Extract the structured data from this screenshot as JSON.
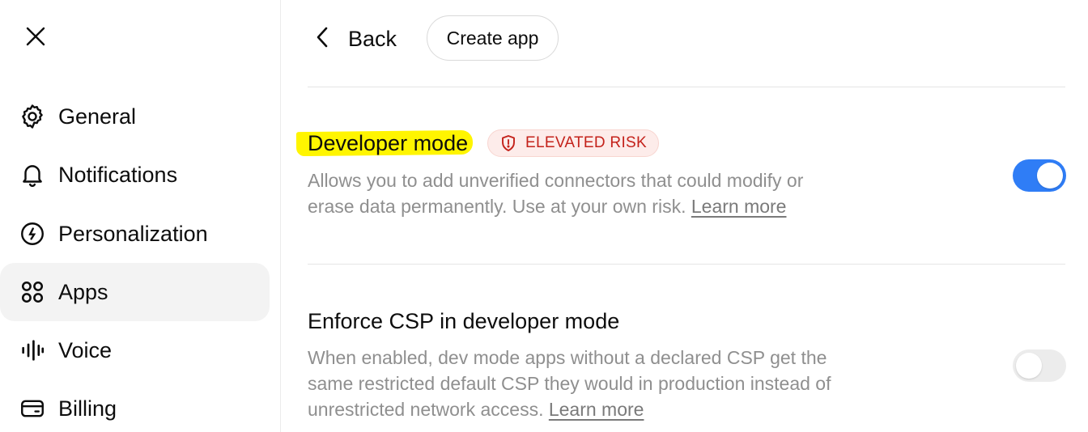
{
  "sidebar": {
    "close_icon": "close-icon",
    "items": [
      {
        "label": "General",
        "icon": "gear-icon",
        "active": false
      },
      {
        "label": "Notifications",
        "icon": "bell-icon",
        "active": false
      },
      {
        "label": "Personalization",
        "icon": "personalization-icon",
        "active": false
      },
      {
        "label": "Apps",
        "icon": "apps-grid-icon",
        "active": true
      },
      {
        "label": "Voice",
        "icon": "voice-wave-icon",
        "active": false
      },
      {
        "label": "Billing",
        "icon": "card-icon",
        "active": false
      }
    ]
  },
  "header": {
    "back_label": "Back",
    "create_app_label": "Create app"
  },
  "settings": {
    "developer_mode": {
      "title": "Developer mode",
      "badge": "ELEVATED RISK",
      "description": "Allows you to add unverified connectors that could modify or erase data permanently. Use at your own risk.",
      "learn_more": "Learn more",
      "enabled": true
    },
    "enforce_csp": {
      "title": "Enforce CSP in developer mode",
      "description": "When enabled, dev mode apps without a declared CSP get the same restricted default CSP they would in production instead of unrestricted network access.",
      "learn_more": "Learn more",
      "enabled": false
    }
  },
  "colors": {
    "accent": "#2f7df6",
    "risk_text": "#c4221b",
    "risk_bg": "#fdecea",
    "highlight": "#fff500"
  }
}
